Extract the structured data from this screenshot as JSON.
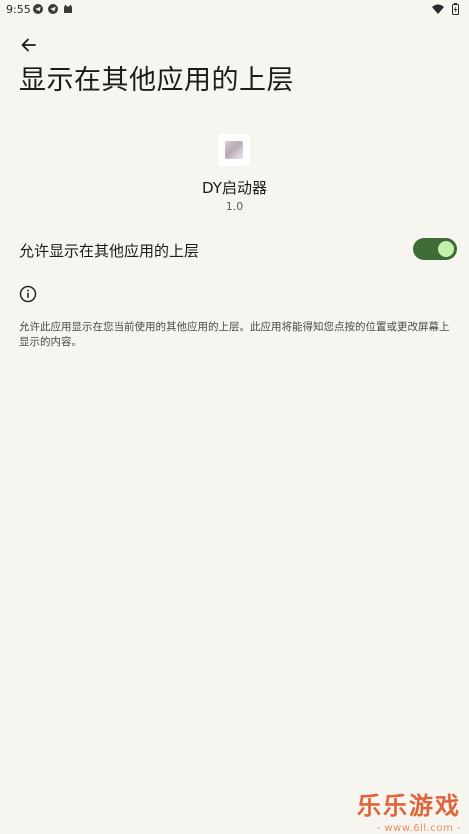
{
  "status_bar": {
    "time": "9:55",
    "left_icons": [
      "telegram-icon",
      "telegram-icon",
      "cat-icon"
    ],
    "right_icons": [
      "wifi-icon",
      "battery-icon"
    ]
  },
  "header": {
    "back_icon": "arrow-left-icon",
    "title": "显示在其他应用的上层"
  },
  "app": {
    "name": "DY启动器",
    "version": "1.0"
  },
  "permission": {
    "label": "允许显示在其他应用的上层",
    "enabled": true,
    "switch_color": "#3f6b36"
  },
  "info": {
    "icon": "info-icon",
    "description": "允许此应用显示在您当前使用的其他应用的上层。此应用将能得知您点按的位置或更改屏幕上显示的内容。"
  },
  "watermark": {
    "title": "乐乐游戏",
    "url": "- www.6ll.com -",
    "color": "#e1643b"
  }
}
